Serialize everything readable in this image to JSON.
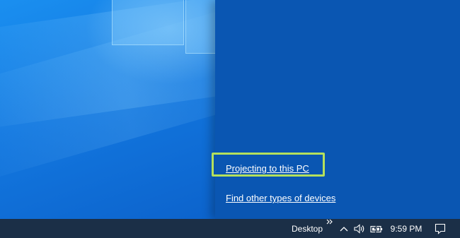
{
  "side_panel": {
    "links": [
      {
        "label": "Projecting to this PC"
      },
      {
        "label": "Find other types of devices"
      }
    ],
    "focus_color": "#b4e05c",
    "background": "#0a56b2"
  },
  "taskbar": {
    "desktop_label": "Desktop",
    "overflow_icon": "double-chevron-right-icon",
    "tray_icons": [
      "chevron-up-icon",
      "volume-icon",
      "battery-icon"
    ],
    "time": "9:59 PM",
    "action_center_icon": "notification-icon",
    "background": "#1b2f47"
  }
}
